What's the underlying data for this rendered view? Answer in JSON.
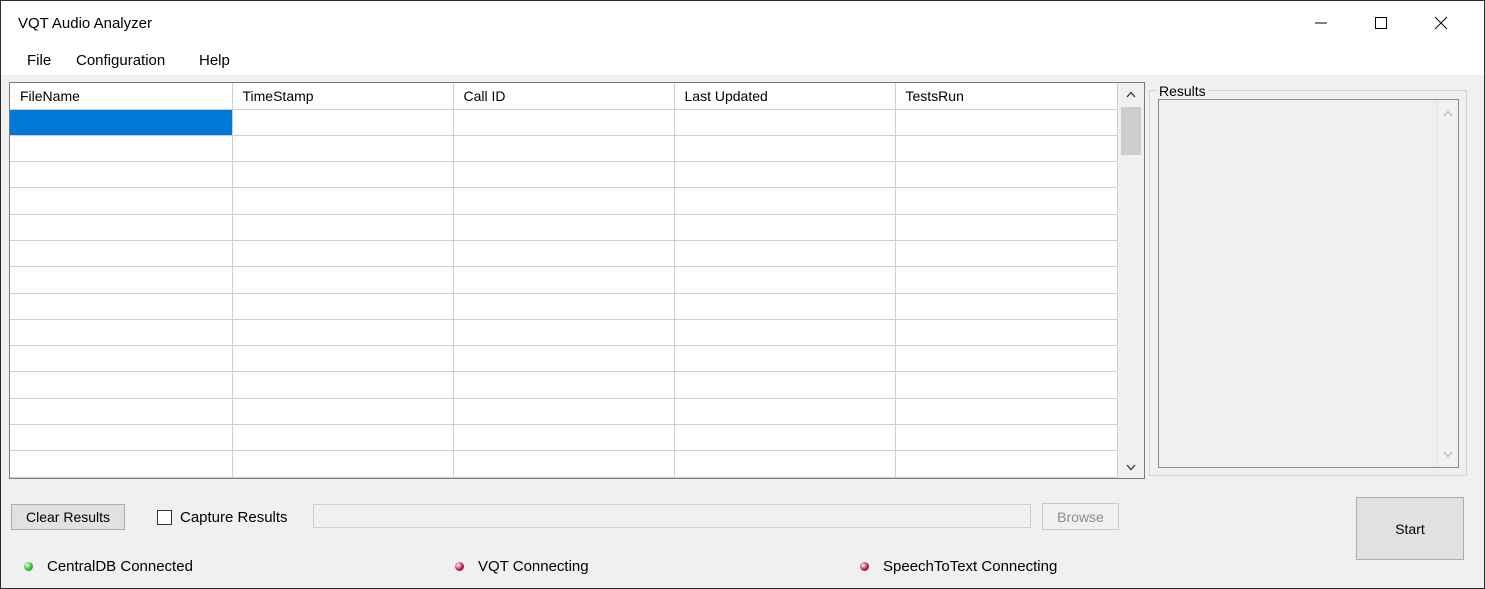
{
  "window": {
    "title": "VQT Audio Analyzer",
    "controls": {
      "minimize": "—",
      "maximize": "☐",
      "close": "✕"
    }
  },
  "menu": [
    "File",
    "Configuration",
    "Help"
  ],
  "grid": {
    "columns": [
      "FileName",
      "TimeStamp",
      "Call ID",
      "Last Updated",
      "TestsRun"
    ],
    "row_count": 14,
    "selected_row": 0,
    "selected_col": 0,
    "selection_color": "#0078d7"
  },
  "results_panel": {
    "label": "Results",
    "content": ""
  },
  "controls": {
    "clear_results": "Clear Results",
    "capture_results_label": "Capture Results",
    "capture_checked": false,
    "path_value": "",
    "browse": "Browse",
    "start": "Start"
  },
  "status": [
    {
      "label": "CentralDB Connected",
      "color": "#1fb81f"
    },
    {
      "label": "VQT Connecting",
      "color": "#b0103a"
    },
    {
      "label": "SpeechToText Connecting",
      "color": "#b0103a"
    }
  ]
}
